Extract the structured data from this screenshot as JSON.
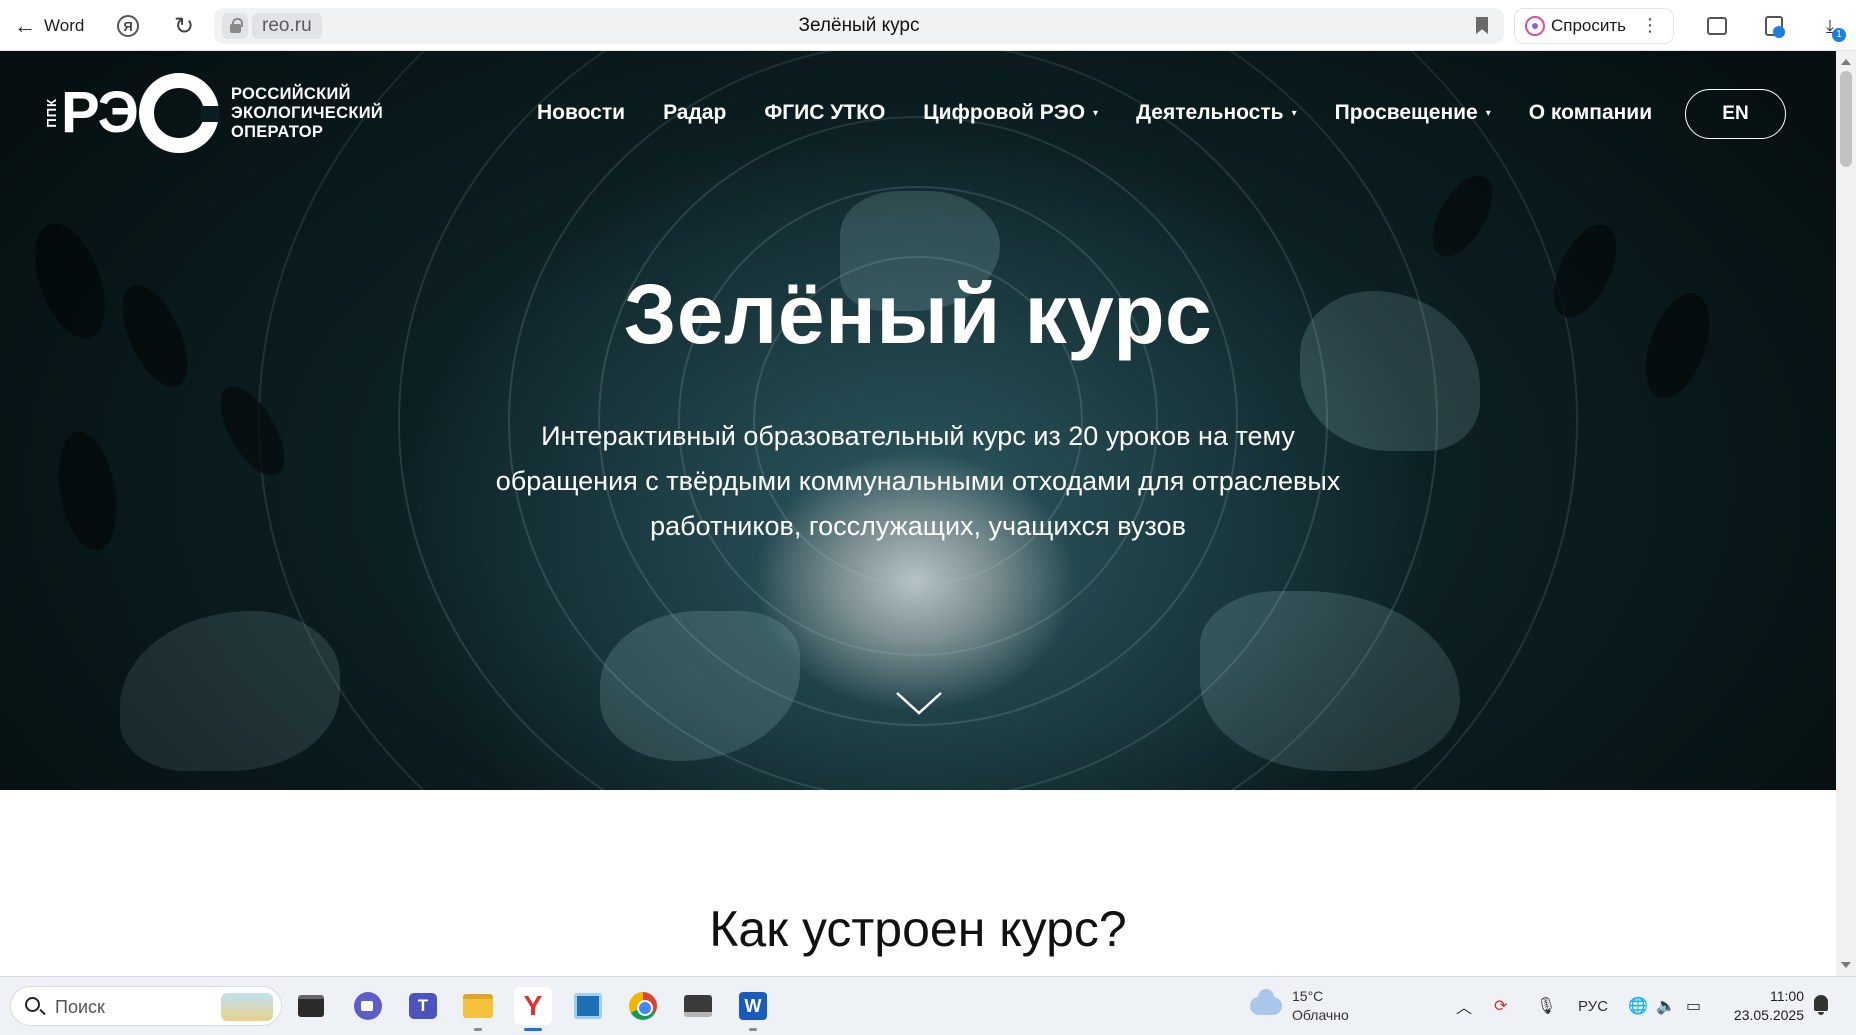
{
  "browser": {
    "back_label": "Word",
    "domain": "reo.ru",
    "tab_title": "Зелёный курс",
    "ask_label": "Спросить",
    "downloads_badge": "1"
  },
  "site": {
    "logo": {
      "ppk": "ППК",
      "reo": "РЭ",
      "lines": [
        "РОССИЙСКИЙ",
        "ЭКОЛОГИЧЕСКИЙ",
        "ОПЕРАТОР"
      ]
    },
    "nav": [
      {
        "label": "Новости",
        "has_dropdown": false
      },
      {
        "label": "Радар",
        "has_dropdown": false
      },
      {
        "label": "ФГИС УТКО",
        "has_dropdown": false
      },
      {
        "label": "Цифровой РЭО",
        "has_dropdown": true
      },
      {
        "label": "Деятельность",
        "has_dropdown": true
      },
      {
        "label": "Просвещение",
        "has_dropdown": true
      },
      {
        "label": "О компании",
        "has_dropdown": false
      }
    ],
    "lang_button": "EN"
  },
  "hero": {
    "title": "Зелёный курс",
    "subtitle": "Интерактивный образовательный курс из 20 уроков на тему обращения с твёрдыми коммунальными отходами для отраслевых работников, госслужащих, учащихся вузов"
  },
  "section": {
    "title": "Как устроен курс?"
  },
  "taskbar": {
    "search_placeholder": "Поиск",
    "weather_temp": "15°C",
    "weather_desc": "Облачно",
    "language": "РУС",
    "time": "11:00",
    "date": "23.05.2025"
  },
  "colors": {
    "hero_dark": "#0c1e22",
    "hero_teal": "#2d5a61",
    "text_white": "#ffffff",
    "accent_blue": "#1a7fe0"
  }
}
